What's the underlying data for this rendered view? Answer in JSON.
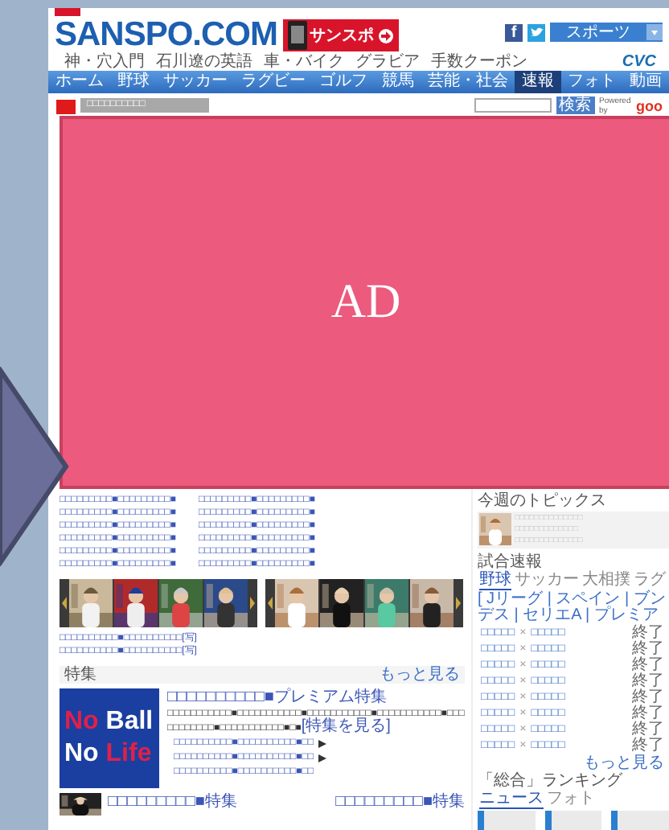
{
  "header": {
    "logo": "SANSPO.COM",
    "banner": "サンスポ",
    "social": "f",
    "select": "スポーツ"
  },
  "subnav": {
    "links": [
      "神・穴入門",
      "石川遼の英語",
      "車・バイク",
      "グラビア",
      "手数クーポン"
    ],
    "partner": "CVC"
  },
  "nav": [
    {
      "label": "ホーム",
      "selected": false
    },
    {
      "label": "野球",
      "selected": false
    },
    {
      "label": "サッカー",
      "selected": false
    },
    {
      "label": "ラグビー",
      "selected": false
    },
    {
      "label": "ゴルフ",
      "selected": false
    },
    {
      "label": "競馬",
      "selected": false
    },
    {
      "label": "芸能・社会",
      "selected": false
    },
    {
      "label": "速報",
      "selected": true
    },
    {
      "label": "フォト",
      "selected": false
    },
    {
      "label": "動画",
      "selected": false
    }
  ],
  "subbar": {
    "breadcrumb": "□□□□□□□□□□",
    "search_button": "検索",
    "powered": "Powered by",
    "goo": "goo"
  },
  "ad": {
    "label": "AD"
  },
  "news_lists": [
    [
      "□□□□□□□□□■□□□□□□□□□■",
      "□□□□□□□□□■□□□□□□□□□■",
      "□□□□□□□□□■□□□□□□□□□■",
      "□□□□□□□□□■□□□□□□□□□■",
      "□□□□□□□□□■□□□□□□□□□■",
      "□□□□□□□□□■□□□□□□□□□■"
    ],
    [
      "□□□□□□□□□■□□□□□□□□□■",
      "□□□□□□□□□■□□□□□□□□□■",
      "□□□□□□□□□■□□□□□□□□□■",
      "□□□□□□□□□■□□□□□□□□□■",
      "□□□□□□□□□■□□□□□□□□□■",
      "□□□□□□□□□■□□□□□□□□□■"
    ]
  ],
  "photo_strips": [
    {
      "photos": [
        {
          "kind": "picture"
        },
        {
          "kind": "picture"
        },
        {
          "kind": "picture"
        },
        {
          "kind": "picture"
        }
      ]
    },
    {
      "photos": [
        {
          "kind": "picture"
        },
        {
          "kind": "picture"
        },
        {
          "kind": "picture"
        },
        {
          "kind": "picture"
        }
      ]
    }
  ],
  "more_links": [
    "□□□□□□□□□□■□□□□□□□□□□[写]",
    "□□□□□□□□□□■□□□□□□□□□□[写]"
  ],
  "feature": {
    "heading": "特集",
    "more": "もっと見る",
    "logo_lines": [
      [
        "No",
        "Ball"
      ],
      [
        "No",
        "Life"
      ]
    ],
    "title": "□□□□□□□□□□■プレミアム特集",
    "body": "□□□□□□□□□□□■□□□□□□□□□□□■□□□□□□□□□□□■□□□□□□□□□□□■□□□□□□□□□□□■□□□□□□□□□□□■□■",
    "body_link": "[特集を見る]",
    "bullets": [
      {
        "text": "□□□□□□□□□□■□□□□□□□□□□■□□",
        "video": true
      },
      {
        "text": "□□□□□□□□□□■□□□□□□□□□□■□□",
        "video": true
      },
      {
        "text": "□□□□□□□□□□■□□□□□□□□□□■□□",
        "video": false
      }
    ]
  },
  "bottom_row": {
    "picture": {
      "kind": "picture"
    },
    "left": "□□□□□□□□□■特集",
    "right": "□□□□□□□□□■特集"
  },
  "sidebar": {
    "topics": {
      "heading": "今週のトピックス",
      "picture": {
        "kind": "picture"
      },
      "lines": [
        "□□□□□□□□□□□□□□",
        "□□□□□□□□□□□□□",
        "□□□□□□□□□□□□□□"
      ]
    },
    "scores": {
      "heading": "試合速報",
      "tabs": [
        {
          "label": "野球",
          "selected": true
        },
        {
          "label": "サッカー",
          "selected": false
        },
        {
          "label": "大相撲",
          "selected": false
        },
        {
          "label": "ラグ",
          "selected": false
        }
      ],
      "leagues": "[ Jリーグ | スペイン | ブンデス | セリエA | プレミア",
      "rows": [
        {
          "home": "□□□□□",
          "vs": "×",
          "away": "□□□□□",
          "status": "終了"
        },
        {
          "home": "□□□□□",
          "vs": "×",
          "away": "□□□□□",
          "status": "終了"
        },
        {
          "home": "□□□□□",
          "vs": "×",
          "away": "□□□□□",
          "status": "終了"
        },
        {
          "home": "□□□□□",
          "vs": "×",
          "away": "□□□□□",
          "status": "終了"
        },
        {
          "home": "□□□□□",
          "vs": "×",
          "away": "□□□□□",
          "status": "終了"
        },
        {
          "home": "□□□□□",
          "vs": "×",
          "away": "□□□□□",
          "status": "終了"
        },
        {
          "home": "□□□□□",
          "vs": "×",
          "away": "□□□□□",
          "status": "終了"
        },
        {
          "home": "□□□□□",
          "vs": "×",
          "away": "□□□□□",
          "status": "終了"
        }
      ],
      "more": "もっと見る"
    },
    "ranking": {
      "heading": "「総合」ランキング",
      "tabs": [
        {
          "label": "ニュース",
          "selected": true
        },
        {
          "label": "フォト",
          "selected": false
        }
      ]
    }
  }
}
